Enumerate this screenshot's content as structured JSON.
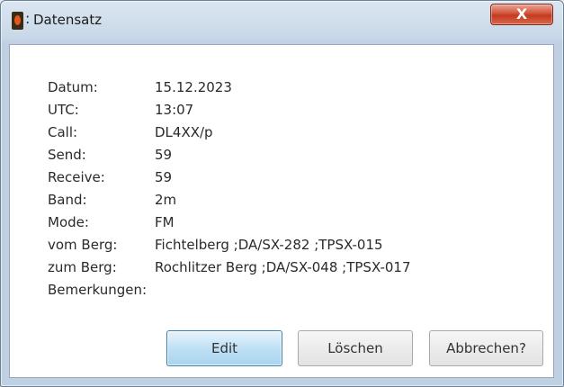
{
  "window": {
    "title": "Datensatz",
    "close_label": "X"
  },
  "fields": [
    {
      "label": "Datum:",
      "value": "15.12.2023"
    },
    {
      "label": "UTC:",
      "value": "13:07"
    },
    {
      "label": "Call:",
      "value": "DL4XX/p"
    },
    {
      "label": "Send:",
      "value": "59"
    },
    {
      "label": "Receive:",
      "value": "59"
    },
    {
      "label": "Band:",
      "value": "2m"
    },
    {
      "label": "Mode:",
      "value": "FM"
    },
    {
      "label": "vom Berg:",
      "value": "Fichtelberg ;DA/SX-282 ;TPSX-015"
    },
    {
      "label": "zum Berg:",
      "value": "Rochlitzer Berg ;DA/SX-048 ;TPSX-017"
    },
    {
      "label": "Bemerkungen:",
      "value": ""
    }
  ],
  "buttons": {
    "edit": "Edit",
    "delete": "Löschen",
    "cancel": "Abbrechen?"
  }
}
